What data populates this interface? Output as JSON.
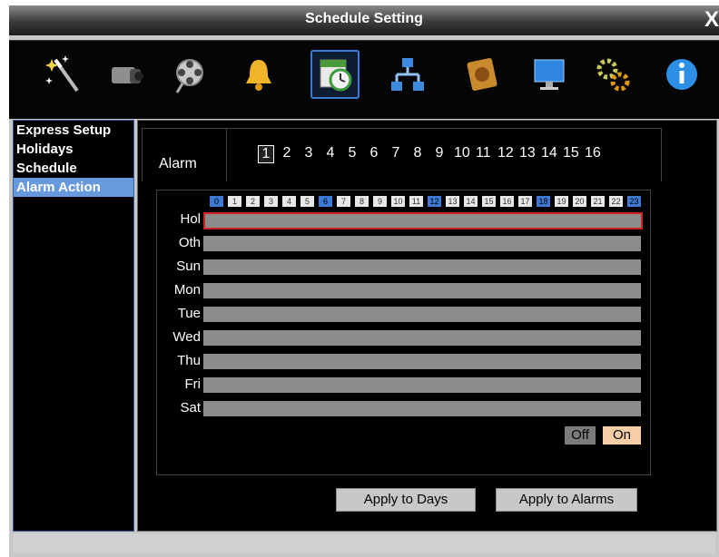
{
  "window": {
    "title": "Schedule Setting",
    "close_glyph": "X"
  },
  "toolbar": {
    "icons": [
      {
        "name": "wizard-wand-icon"
      },
      {
        "name": "camera-icon"
      },
      {
        "name": "film-reel-icon"
      },
      {
        "name": "alarm-bell-icon"
      },
      {
        "name": "schedule-calendar-icon",
        "selected": true
      },
      {
        "name": "network-icon"
      },
      {
        "name": "hard-disk-icon"
      },
      {
        "name": "monitor-display-icon"
      },
      {
        "name": "settings-gears-icon"
      },
      {
        "name": "info-icon"
      }
    ]
  },
  "sidebar": {
    "items": [
      {
        "label": "Express Setup"
      },
      {
        "label": "Holidays"
      },
      {
        "label": "Schedule"
      },
      {
        "label": "Alarm Action",
        "selected": true
      }
    ]
  },
  "main": {
    "alarm_label": "Alarm",
    "alarm_numbers": [
      "1",
      "2",
      "3",
      "4",
      "5",
      "6",
      "7",
      "8",
      "9",
      "10",
      "11",
      "12",
      "13",
      "14",
      "15",
      "16"
    ],
    "selected_alarm": "1",
    "hours": [
      "0",
      "1",
      "2",
      "3",
      "4",
      "5",
      "6",
      "7",
      "8",
      "9",
      "10",
      "11",
      "12",
      "13",
      "14",
      "15",
      "16",
      "17",
      "18",
      "19",
      "20",
      "21",
      "22",
      "23"
    ],
    "highlighted_hours": [
      "0",
      "6",
      "12",
      "18",
      "23"
    ],
    "days": [
      "Hol",
      "Oth",
      "Sun",
      "Mon",
      "Tue",
      "Wed",
      "Thu",
      "Fri",
      "Sat"
    ],
    "selected_day": "Hol",
    "off_label": "Off",
    "on_label": "On",
    "apply_days_label": "Apply to Days",
    "apply_alarms_label": "Apply to Alarms"
  },
  "colors": {
    "accent": "#3d7ad6",
    "selection_border": "#d32020",
    "on_color": "#f7cfa6",
    "off_color": "#7b7b7b",
    "bar_color": "#8c8c8c"
  }
}
